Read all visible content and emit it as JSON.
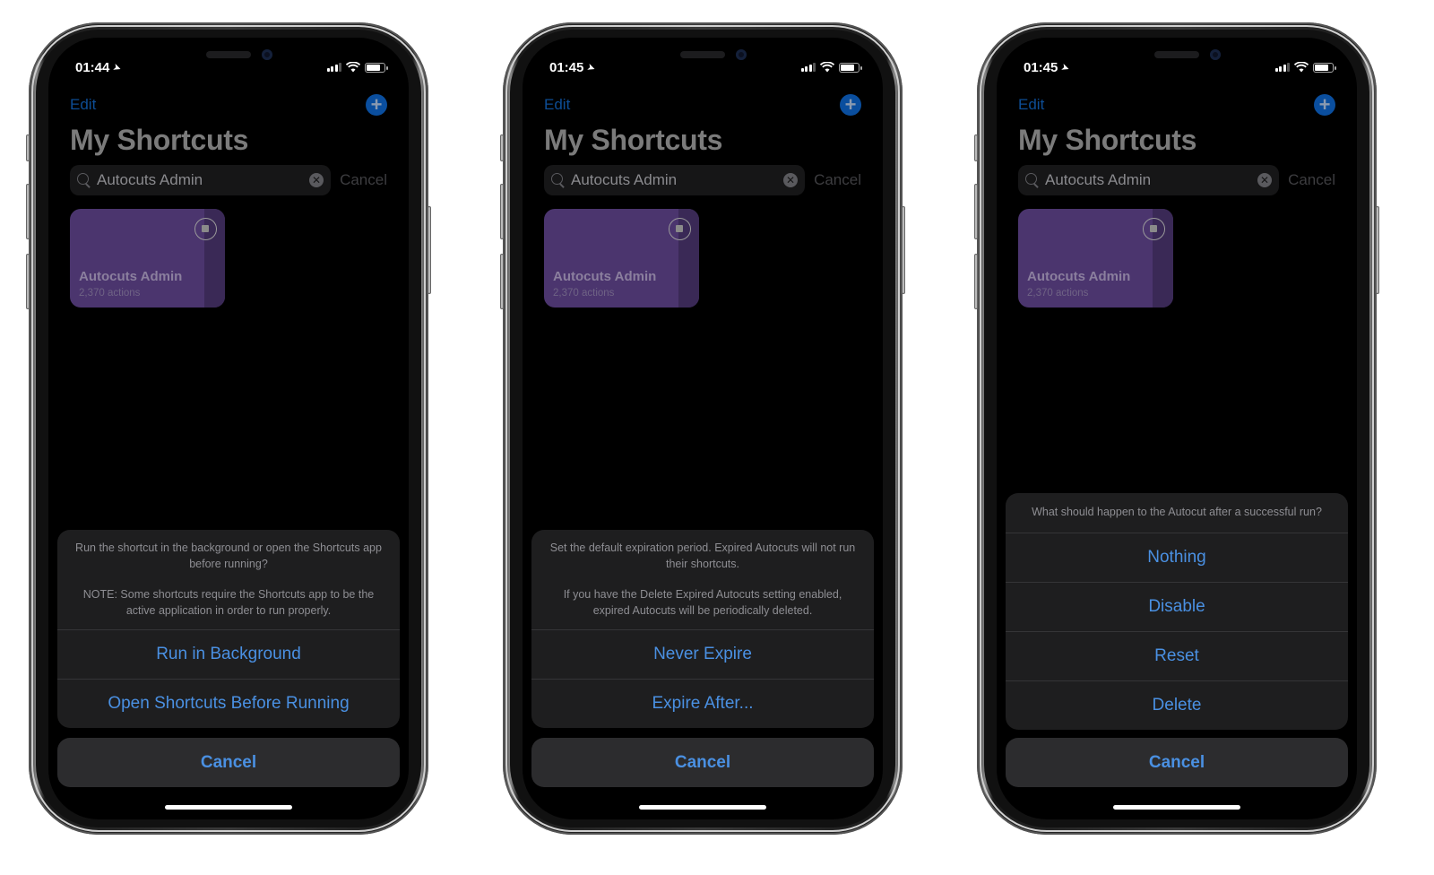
{
  "colors": {
    "accent": "#4a90e2",
    "nav_accent": "#0d4d95",
    "card_bg": "#4b356e",
    "sheet_bg": "#1e1e1f",
    "screen_bg": "#000000"
  },
  "phones": [
    {
      "status": {
        "time": "01:44",
        "location_icon": "location-arrow-icon",
        "signal_icon": "cellular-signal-icon",
        "wifi_icon": "wifi-icon",
        "battery_icon": "battery-icon"
      },
      "nav": {
        "edit_label": "Edit",
        "add_icon": "plus-icon"
      },
      "title": "My Shortcuts",
      "search": {
        "value": "Autocuts Admin",
        "cancel_label": "Cancel"
      },
      "card": {
        "name": "Autocuts Admin",
        "subtitle": "2,370 actions"
      },
      "sheet": {
        "message": [
          "Run the shortcut in the background or open the Shortcuts app before running?",
          "NOTE: Some shortcuts require the Shortcuts app to be the active application in order to run properly."
        ],
        "actions": [
          "Run in Background",
          "Open Shortcuts Before Running"
        ],
        "cancel_label": "Cancel"
      }
    },
    {
      "status": {
        "time": "01:45",
        "location_icon": "location-arrow-icon",
        "signal_icon": "cellular-signal-icon",
        "wifi_icon": "wifi-icon",
        "battery_icon": "battery-icon"
      },
      "nav": {
        "edit_label": "Edit",
        "add_icon": "plus-icon"
      },
      "title": "My Shortcuts",
      "search": {
        "value": "Autocuts Admin",
        "cancel_label": "Cancel"
      },
      "card": {
        "name": "Autocuts Admin",
        "subtitle": "2,370 actions"
      },
      "sheet": {
        "message": [
          "Set the default expiration period. Expired Autocuts will not run their shortcuts.",
          "If you have the Delete Expired Autocuts setting enabled, expired Autocuts will be periodically deleted."
        ],
        "actions": [
          "Never Expire",
          "Expire After..."
        ],
        "cancel_label": "Cancel"
      }
    },
    {
      "status": {
        "time": "01:45",
        "location_icon": "location-arrow-icon",
        "signal_icon": "cellular-signal-icon",
        "wifi_icon": "wifi-icon",
        "battery_icon": "battery-icon"
      },
      "nav": {
        "edit_label": "Edit",
        "add_icon": "plus-icon"
      },
      "title": "My Shortcuts",
      "search": {
        "value": "Autocuts Admin",
        "cancel_label": "Cancel"
      },
      "card": {
        "name": "Autocuts Admin",
        "subtitle": "2,370 actions"
      },
      "sheet": {
        "message": [
          "What should happen to the Autocut after a successful run?"
        ],
        "actions": [
          "Nothing",
          "Disable",
          "Reset",
          "Delete"
        ],
        "cancel_label": "Cancel"
      }
    }
  ]
}
